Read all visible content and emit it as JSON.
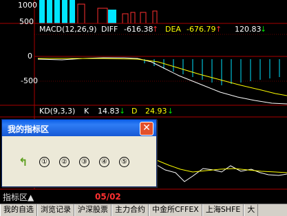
{
  "top_axis": {
    "tick_1000": "1000",
    "tick_500": "500"
  },
  "macd": {
    "title": "MACD(12,26,9)",
    "diff_label": "DIFF",
    "diff_value": "-616.38",
    "diff_arrow": "↑",
    "dea_label": "DEA",
    "dea_value": "-676.79",
    "dea_arrow": "↑",
    "macd_value": "120.83",
    "macd_arrow": "↓",
    "tick_0": "0",
    "tick_neg500": "-500"
  },
  "kd": {
    "title": "KD(9,3,3)",
    "k_label": "K",
    "k_value": "14.83",
    "k_arrow": "↓",
    "d_label": "D",
    "d_value": "24.93",
    "d_arrow": "↓"
  },
  "dialog": {
    "title": "我的指标区",
    "close_symbol": "✕",
    "back_symbol": "↰",
    "slots": [
      "①",
      "②",
      "③",
      "④",
      "⑤"
    ]
  },
  "footer": {
    "indicator_label": "指标区▲",
    "date": "05/02"
  },
  "tabs": [
    "我的自选",
    "浏览记录",
    "沪深股票",
    "主力合约",
    "中金所CFFEX",
    "上海SHFE",
    "大"
  ]
}
